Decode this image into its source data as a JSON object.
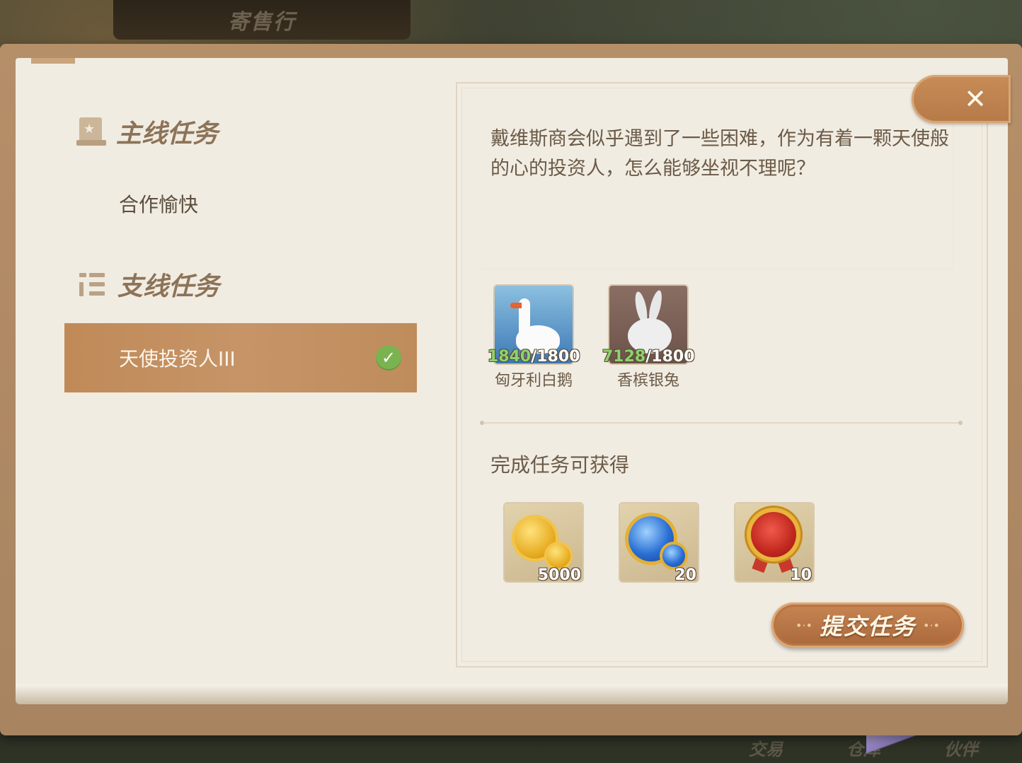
{
  "background": {
    "top_banner": "寄售行",
    "bottom_nav": [
      "交易",
      "仓库",
      "伙伴"
    ]
  },
  "left": {
    "main_section": {
      "title": "主线任务",
      "icon": "scroll-star-icon"
    },
    "main_quests": [
      {
        "label": "合作愉快"
      }
    ],
    "side_section": {
      "title": "支线任务",
      "icon": "list-icon"
    },
    "side_quests": [
      {
        "label": "天使投资人III",
        "selected": true,
        "completed": true
      }
    ]
  },
  "detail": {
    "description": "戴维斯商会似乎遇到了一些困难，作为有着一颗天使般的心的投资人，怎么能够坐视不理呢？",
    "requirements": [
      {
        "have": "1840",
        "need": "/1800",
        "name": "匈牙利白鹅",
        "icon": "goose-icon"
      },
      {
        "have": "7128",
        "need": "/1800",
        "name": "香槟银兔",
        "icon": "rabbit-icon"
      }
    ],
    "reward_title": "完成任务可获得",
    "rewards": [
      {
        "icon": "gold-coin-icon",
        "amount": "5000"
      },
      {
        "icon": "blue-gem-icon",
        "amount": "20"
      },
      {
        "icon": "medal-icon",
        "amount": "10"
      }
    ],
    "submit_label": "提交任务",
    "close_icon": "close-icon"
  },
  "colors": {
    "paper": "#f1ece2",
    "frame": "#b58f68",
    "selected_row": "#c08a58",
    "check_green": "#7ab34f",
    "count_green": "#8ed36c"
  }
}
